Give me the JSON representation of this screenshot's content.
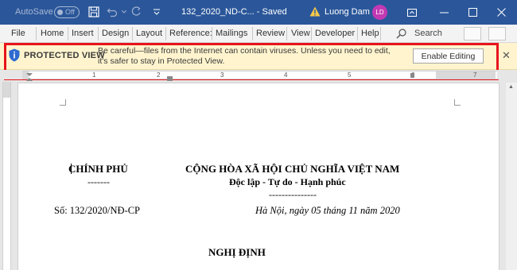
{
  "titlebar": {
    "autosave_label": "AutoSave",
    "autosave_state": "Off",
    "doc_title": "132_2020_ND-C... - Saved",
    "user_name": "Luong Dam",
    "user_initials": "LD"
  },
  "ribbon": {
    "tabs": [
      "File",
      "Home",
      "Insert",
      "Design",
      "Layout",
      "Reference:",
      "Mailings",
      "Review",
      "View",
      "Developer",
      "Help"
    ],
    "search_label": "Search"
  },
  "protected_view": {
    "title": "PROTECTED VIEW",
    "message": "Be careful—files from the Internet can contain viruses. Unless you need to edit, it's safer to stay in Protected View.",
    "button_label": "Enable Editing",
    "close_glyph": "✕"
  },
  "ruler": {
    "numbers": [
      "1",
      "2",
      "3",
      "4",
      "5",
      "6",
      "7"
    ]
  },
  "document": {
    "left_heading": "CHÍNH PHỦ",
    "left_rule": "-------",
    "right_heading": "CỘNG HÒA XÃ HỘI CHỦ NGHĨA VIỆT NAM",
    "motto": "Độc lập - Tự do - Hạnh phúc",
    "right_rule": "---------------",
    "doc_number": "Số: 132/2020/NĐ-CP",
    "place_date": "Hà Nội, ngày 05 tháng 11 năm 2020",
    "doc_type": "NGHỊ ĐỊNH"
  },
  "colors": {
    "titlebar": "#2b579a",
    "ribbon": "#f3f3f3",
    "protected_view_bar": "#fff4ce",
    "highlight_frame": "#e8141c",
    "avatar": "#c239b3"
  }
}
